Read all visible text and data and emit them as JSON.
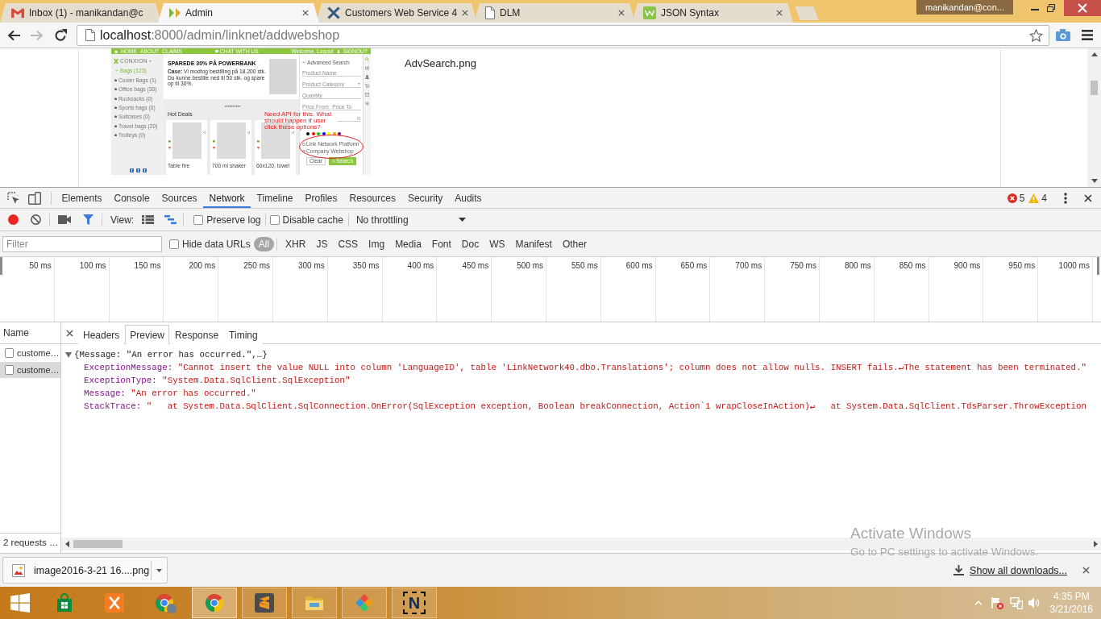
{
  "browser": {
    "tabs": [
      {
        "kind": "mail",
        "title": "Inbox (1) - manikandan@c",
        "selected": false,
        "closable": false
      },
      {
        "kind": "admin",
        "title": "Admin",
        "selected": true,
        "closable": true
      },
      {
        "kind": "tools",
        "title": "Customers Web Service 4",
        "selected": false,
        "closable": true
      },
      {
        "kind": "page",
        "title": "DLM",
        "selected": false,
        "closable": true
      },
      {
        "kind": "w3",
        "title": "JSON Syntax",
        "selected": false,
        "closable": true
      }
    ],
    "profile": "manikandan@con...",
    "forward_disabled": true,
    "address": {
      "host": "localhost",
      "path": ":8000/admin/linknet/addwebshop"
    }
  },
  "page": {
    "mockup": {
      "nav": [
        "HOME",
        "ABOUT",
        "CLAIMS"
      ],
      "chat": "CHAT WITH US",
      "account": "Welcome, Logout",
      "signout": "SIGNOUT",
      "logo": "CONXION",
      "category": "Bags (123)",
      "categories": [
        "Cooler Bags (1)",
        "Office bags (30)",
        "Rucksacks (0)",
        "Sports bags (0)",
        "Suitcases (0)",
        "Travel bags (20)",
        "Trolleys (0)"
      ],
      "banner": {
        "headline": "SPAREDE 30% PÅ POWERBANK",
        "lines": [
          "**Case:** Vi modtog bestilling på 18.200 stk.",
          "Du kunne bestille ned til 50 stk. og spare op til 30%."
        ]
      },
      "section": "Hot Deals",
      "products": [
        "Table fire",
        "700 ml shaker",
        "60x120, towel"
      ],
      "search": {
        "title": "Advanced Search",
        "fields": [
          {
            "kind": "text",
            "placeholder": "Product Name"
          },
          {
            "kind": "select",
            "placeholder": "Product Category"
          },
          {
            "kind": "text",
            "placeholder": "Quantity"
          },
          {
            "kind": "half",
            "placeholder": "Price From"
          },
          {
            "kind": "half",
            "placeholder": "Price To"
          },
          {
            "kind": "date"
          }
        ],
        "colors": [
          {
            "color": "#000000"
          },
          {
            "color": "#ff0000"
          },
          {
            "color": "#00cc00"
          },
          {
            "color": "#0000ff"
          },
          {
            "color": "#ffff00"
          },
          {
            "color": "#ff9900"
          },
          {
            "color": "#800080"
          }
        ],
        "options": [
          {
            "label": "Link Network Platform",
            "selected": false
          },
          {
            "label": "Company Webshop",
            "selected": false
          }
        ],
        "buttons": [
          {
            "kind": "secondary",
            "label": "Clear"
          },
          {
            "kind": "primary",
            "label": "Search"
          }
        ]
      },
      "note": "Need API for this. What should happen if user click these options?"
    },
    "caption": "AdvSearch.png"
  },
  "devtools": {
    "panels": [
      {
        "label": "Elements",
        "selected": false
      },
      {
        "label": "Console",
        "selected": false
      },
      {
        "label": "Sources",
        "selected": false
      },
      {
        "label": "Network",
        "selected": true
      },
      {
        "label": "Timeline",
        "selected": false
      },
      {
        "label": "Profiles",
        "selected": false
      },
      {
        "label": "Resources",
        "selected": false
      },
      {
        "label": "Security",
        "selected": false
      },
      {
        "label": "Audits",
        "selected": false
      }
    ],
    "errors": "5",
    "warnings": "4",
    "toolbar": {
      "recording": true,
      "screenshots": false,
      "filter_on": true,
      "large_rows": false,
      "overview": true,
      "view_label": "View:",
      "preserve_log": {
        "label": "Preserve log",
        "checked": false
      },
      "disable_cache": {
        "label": "Disable cache",
        "checked": false
      },
      "throttling": "No throttling"
    },
    "filter": {
      "placeholder": "Filter",
      "hide_data_urls": {
        "label": "Hide data URLs",
        "checked": false
      },
      "types": [
        {
          "label": "All",
          "selected": true
        },
        {
          "label": "XHR",
          "selected": false
        },
        {
          "label": "JS",
          "selected": false
        },
        {
          "label": "CSS",
          "selected": false
        },
        {
          "label": "Img",
          "selected": false
        },
        {
          "label": "Media",
          "selected": false
        },
        {
          "label": "Font",
          "selected": false
        },
        {
          "label": "Doc",
          "selected": false
        },
        {
          "label": "WS",
          "selected": false
        },
        {
          "label": "Manifest",
          "selected": false
        },
        {
          "label": "Other",
          "selected": false
        }
      ]
    },
    "overview": {
      "ticks": [
        "50 ms",
        "100 ms",
        "150 ms",
        "200 ms",
        "250 ms",
        "300 ms",
        "350 ms",
        "400 ms",
        "450 ms",
        "500 ms",
        "550 ms",
        "600 ms",
        "650 ms",
        "700 ms",
        "750 ms",
        "800 ms",
        "850 ms",
        "900 ms",
        "950 ms",
        "1000 ms"
      ]
    },
    "requests": {
      "header": "Name",
      "rows": [
        {
          "name": "custome…",
          "selected": false
        },
        {
          "name": "custome…",
          "selected": true
        }
      ],
      "summary": "2 requests …"
    },
    "detail": {
      "tabs": [
        {
          "label": "Headers",
          "selected": false
        },
        {
          "label": "Preview",
          "selected": true
        },
        {
          "label": "Response",
          "selected": false
        },
        {
          "label": "Timing",
          "selected": false
        }
      ],
      "preview": {
        "expanded": true,
        "summary": "{Message: \"An error has occurred.\",…}",
        "properties": [
          {
            "key": "ExceptionMessage:",
            "value": "\"Cannot insert the value NULL into column 'LanguageID', table 'LinkNetwork40.dbo.Translations'; column does not allow nulls. INSERT fails.↵The statement has been terminated.\""
          },
          {
            "key": "ExceptionType:",
            "value": "\"System.Data.SqlClient.SqlException\""
          },
          {
            "key": "Message:",
            "value": "\"An error has occurred.\""
          },
          {
            "key": "StackTrace:",
            "value": "\"   at System.Data.SqlClient.SqlConnection.OnError(SqlException exception, Boolean breakConnection, Action`1 wrapCloseInAction)↵   at System.Data.SqlClient.TdsParser.ThrowException"
          }
        ]
      }
    }
  },
  "activation": {
    "title": "Activate Windows",
    "message": "Go to PC settings to activate Windows."
  },
  "downloads": {
    "items": [
      {
        "file": "image2016-3-21 16....png"
      }
    ],
    "show_all": "Show all downloads..."
  },
  "taskbar": {
    "apps": [
      {
        "kind": "store",
        "running": false,
        "active": false,
        "avatar": false
      },
      {
        "kind": "xampp",
        "running": false,
        "active": false,
        "avatar": false
      },
      {
        "kind": "chrome",
        "running": false,
        "active": false,
        "avatar": true
      },
      {
        "kind": "chrome",
        "running": true,
        "active": true,
        "avatar": false
      },
      {
        "kind": "sublime",
        "running": true,
        "active": false,
        "avatar": false
      },
      {
        "kind": "explorer",
        "running": true,
        "active": false,
        "avatar": false
      },
      {
        "kind": "diamond",
        "running": true,
        "active": false,
        "avatar": false
      },
      {
        "kind": "snip",
        "glyph": "N",
        "running": true,
        "active": false,
        "avatar": false
      }
    ],
    "clock": {
      "time": "4:35 PM",
      "date": "3/21/2016"
    }
  }
}
